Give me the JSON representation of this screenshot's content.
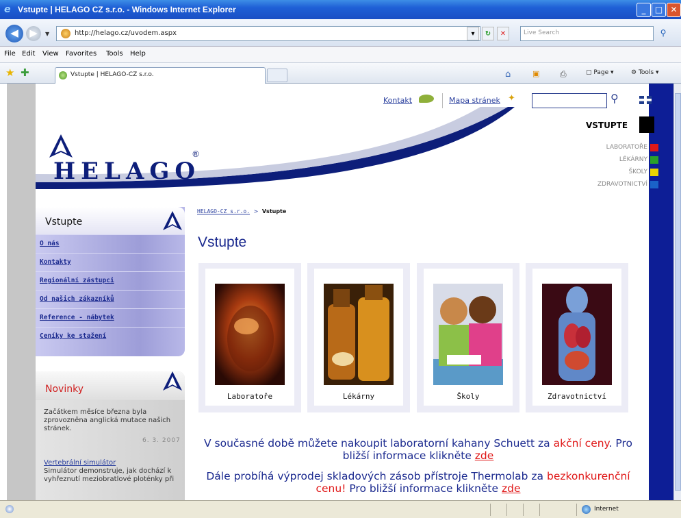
{
  "window": {
    "title": "Vstupte | HELAGO CZ s.r.o. - Windows Internet Explorer"
  },
  "address": {
    "url": "http://helago.cz/uvodem.aspx",
    "live_search_placeholder": "Live Search"
  },
  "menu": [
    "File",
    "Edit",
    "View",
    "Favorites",
    "Tools",
    "Help"
  ],
  "tabs": [
    {
      "label": "Vstupte | HELAGO-CZ s.r.o."
    }
  ],
  "commands": {
    "page": "Page",
    "tools": "Tools"
  },
  "site": {
    "top_links": {
      "kontakt": "Kontakt",
      "mapa": "Mapa stránek"
    },
    "logo_text": "HELAGO",
    "logo_reg": "®",
    "sections": {
      "current": "VSTUPTE",
      "items": [
        {
          "label": "LABORATOŘE",
          "color": "#e01818"
        },
        {
          "label": "LÉKÁRNY",
          "color": "#2aa02a"
        },
        {
          "label": "ŠKOLY",
          "color": "#e8d400"
        },
        {
          "label": "ZDRAVOTNICTVÍ",
          "color": "#1a62c8"
        }
      ]
    },
    "left_nav": {
      "title": "Vstupte",
      "links": [
        "O nás",
        "Kontakty",
        "Regionální zástupci",
        "Od našich zákazníků",
        "Reference - nábytek",
        "Ceníky ke stažení"
      ]
    },
    "news": {
      "title": "Novinky",
      "item1_text": "Začátkem měsíce března byla zprovozněna anglická mutace našich stránek.",
      "item1_date": "6. 3. 2007",
      "item2_title": "Vertebrální simulátor",
      "item2_text": "Simulátor demonstruje, jak dochází k vyhřeznutí meziobratlové ploténky při"
    },
    "breadcrumb": {
      "home": "HELAGO-CZ s.r.o.",
      "sep": ">",
      "current": "Vstupte"
    },
    "page_title": "Vstupte",
    "cards": [
      "Laboratoře",
      "Lékárny",
      "Školy",
      "Zdravotnictví"
    ],
    "promo1": {
      "text": "V současné době můžete nakoupit laboratorní kahany Schuett za",
      "red": "akční ceny",
      "mid": ". Pro bližší informace klikněte",
      "link": "zde"
    },
    "promo2": {
      "text": "Dále probíhá výprodej skladových zásob přístroje Thermolab za",
      "red": "bezkonkurenční cenu!",
      "mid": " Pro bližší informace klikněte",
      "link": "zde"
    }
  },
  "status": {
    "zone": "Internet"
  },
  "colors": {
    "brand_navy": "#0d1e7a",
    "accent_red": "#e01818",
    "link_blue": "#2a3f9e"
  }
}
